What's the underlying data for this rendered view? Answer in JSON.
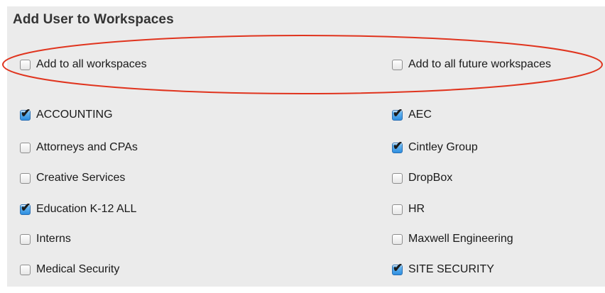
{
  "title": "Add User to Workspaces",
  "global_options": [
    {
      "label": "Add to all workspaces",
      "checked": false
    },
    {
      "label": "Add to all future workspaces",
      "checked": false
    }
  ],
  "workspaces_left": [
    {
      "label": "ACCOUNTING",
      "checked": true
    },
    {
      "label": "Attorneys and CPAs",
      "checked": false
    },
    {
      "label": "Creative Services",
      "checked": false
    },
    {
      "label": "Education K-12 ALL",
      "checked": true
    },
    {
      "label": "Interns",
      "checked": false
    },
    {
      "label": "Medical Security",
      "checked": false
    }
  ],
  "workspaces_right": [
    {
      "label": "AEC",
      "checked": true
    },
    {
      "label": "Cintley Group",
      "checked": true
    },
    {
      "label": "DropBox",
      "checked": false
    },
    {
      "label": "HR",
      "checked": false
    },
    {
      "label": "Maxwell Engineering",
      "checked": false
    },
    {
      "label": "SITE SECURITY",
      "checked": true
    }
  ],
  "colors": {
    "panel": "#ebebeb",
    "annotation": "#e0341e",
    "check_accent": "#2d8ee0"
  },
  "icons": {
    "checked": "checkmark-icon"
  }
}
